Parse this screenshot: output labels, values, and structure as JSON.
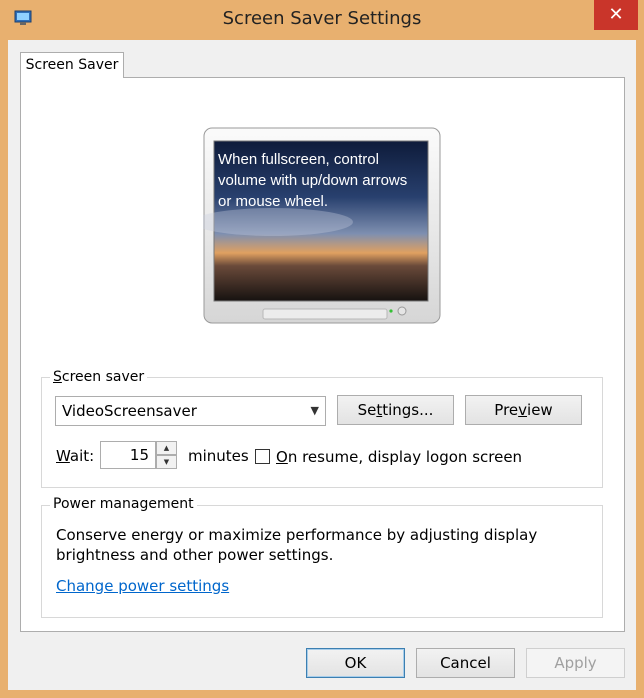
{
  "window": {
    "title": "Screen Saver Settings",
    "close_glyph": "✕"
  },
  "tab": {
    "label": "Screen Saver"
  },
  "preview": {
    "message": "When fullscreen, control volume with up/down arrows or mouse wheel."
  },
  "screen_saver": {
    "legend_first": "S",
    "legend_rest": "creen saver",
    "selected": "VideoScreensaver",
    "settings_label": "Settings...",
    "settings_key_pre": "Se",
    "settings_key": "t",
    "settings_key_post": "tings...",
    "preview_pre": "Pre",
    "preview_key": "v",
    "preview_post": "iew",
    "wait_key": "W",
    "wait_rest": "ait:",
    "wait_value": "15",
    "minutes": "minutes",
    "resume_key": "O",
    "resume_rest": "n resume, display logon screen"
  },
  "power": {
    "legend": "Power management",
    "description_line1": "Conserve energy or maximize performance by adjusting display",
    "description_line2": "brightness and other power settings.",
    "link": "Change power settings"
  },
  "footer": {
    "ok": "OK",
    "cancel": "Cancel",
    "apply": "Apply"
  },
  "colors": {
    "frame": "#e8b06f",
    "close": "#c9352a",
    "link": "#0066cc"
  },
  "icons": {
    "app": "display-settings-icon",
    "dropdown": "chevron-down-icon"
  }
}
